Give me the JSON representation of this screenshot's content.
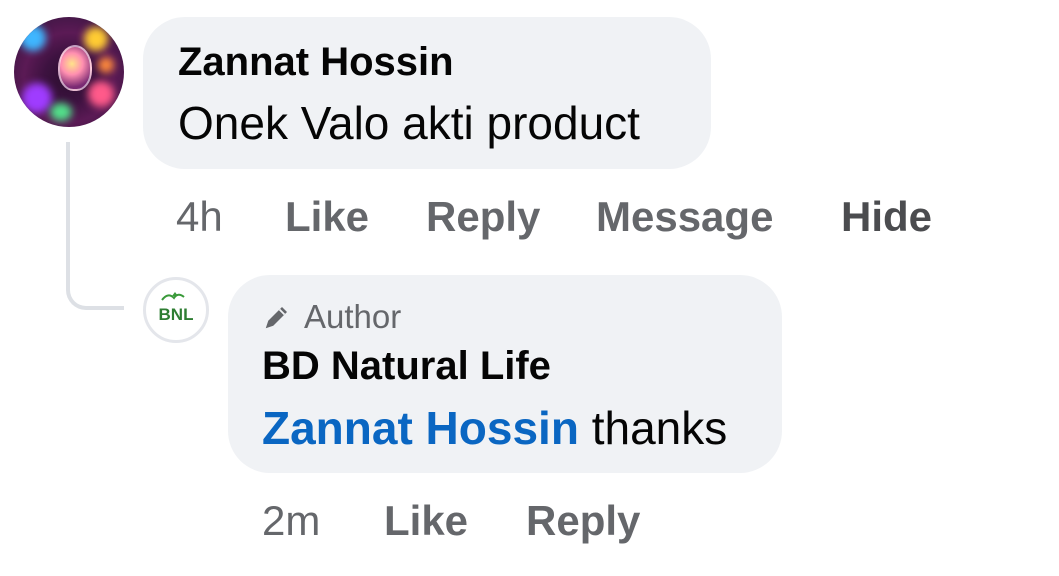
{
  "comment": {
    "author": "Zannat Hossin",
    "text": "Onek Valo akti product",
    "time": "4h",
    "actions": {
      "like": "Like",
      "reply": "Reply",
      "message": "Message",
      "hide": "Hide"
    }
  },
  "reply": {
    "badge": "Author",
    "author": "BD Natural Life",
    "mention": "Zannat Hossin",
    "text": " thanks",
    "time": "2m",
    "avatar_text": "BNL",
    "actions": {
      "like": "Like",
      "reply": "Reply"
    }
  },
  "colors": {
    "bubble": "#f0f2f5",
    "text": "#050505",
    "secondary": "#65676b",
    "mention": "#0a66c2",
    "brand_green": "#2e8b2e"
  }
}
